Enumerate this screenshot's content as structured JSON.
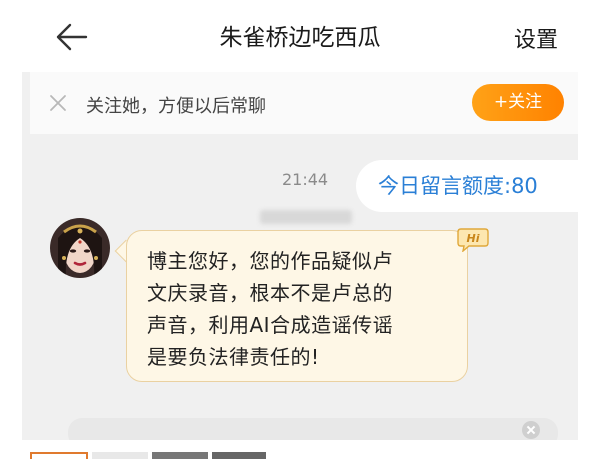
{
  "header": {
    "title": "朱雀桥边吃西瓜",
    "settings_label": "设置"
  },
  "follow_bar": {
    "text": "关注她，方便以后常聊",
    "follow_button_label": "+关注"
  },
  "chat": {
    "time": "21:44",
    "quota_label": "今日留言额度:80",
    "message_lines": [
      "博主您好，您的作品疑似卢",
      "文庆录音，根本不是卢总的",
      "声音，利用AI合成造谣传谣",
      "是要负法律责任的!"
    ],
    "badge_text": "Hi"
  },
  "colors": {
    "accent_orange": "#ff8a00",
    "quota_blue": "#2a7fd6",
    "bubble_bg": "#fef7e6"
  },
  "icons": [
    "back-arrow-icon",
    "close-icon",
    "hi-badge-icon",
    "clear-icon"
  ]
}
